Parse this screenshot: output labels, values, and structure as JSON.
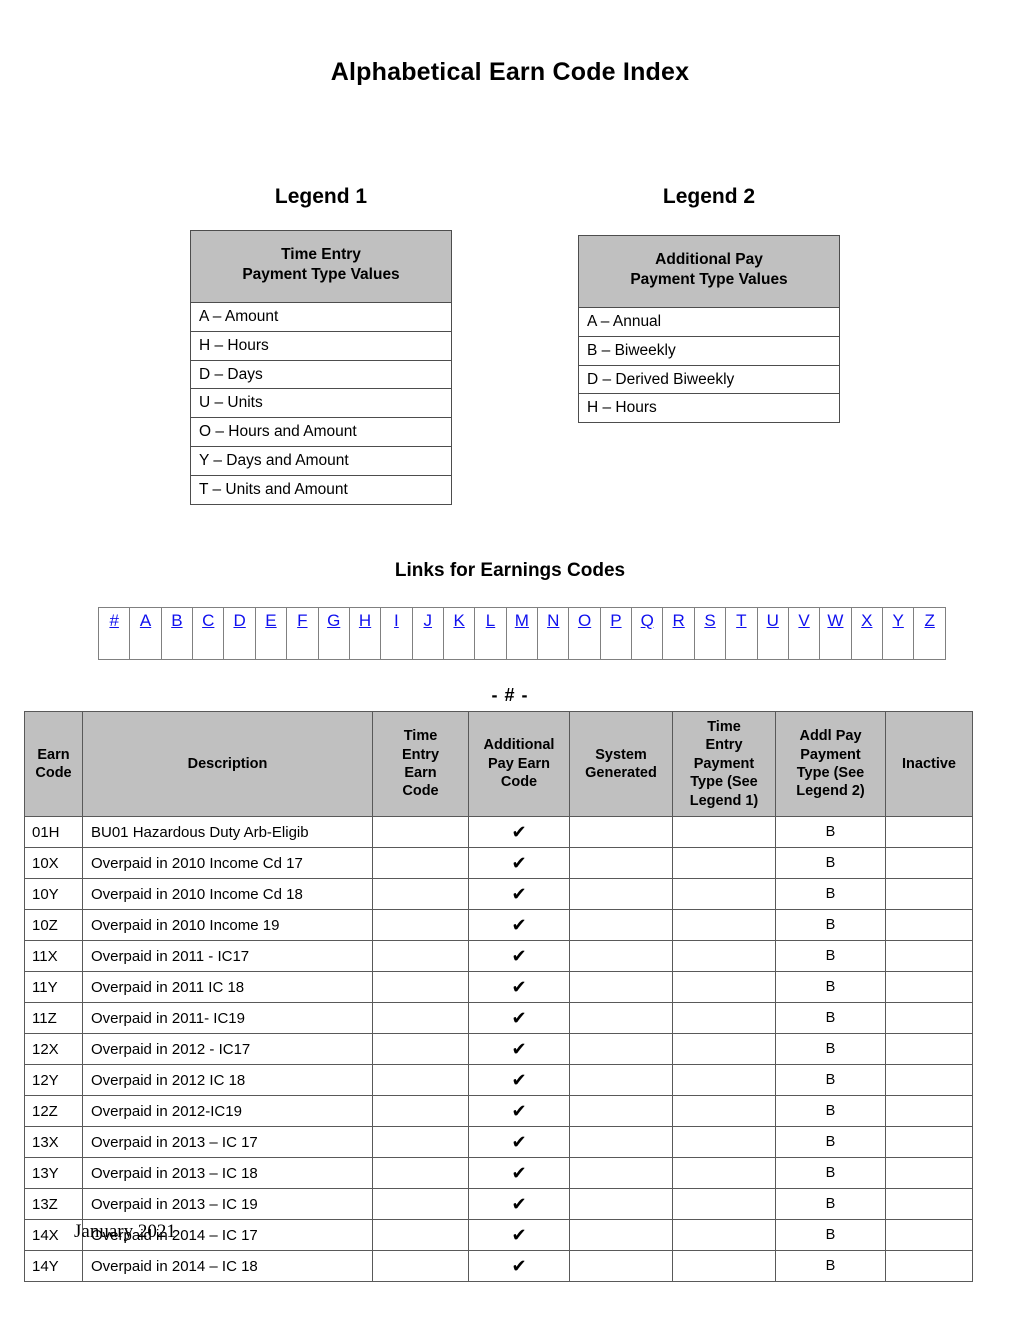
{
  "document": {
    "title": "Alphabetical Earn Code Index",
    "footer_date": "January 2021",
    "section_marker": "- # -",
    "header_gray": "#c0c0c0",
    "link_color": "#1010ee"
  },
  "legend1": {
    "heading": "Legend 1",
    "header_line1": "Time Entry",
    "header_line2": "Payment Type Values",
    "rows": [
      "A – Amount",
      "H – Hours",
      "D – Days",
      "U – Units",
      "O – Hours and Amount",
      "Y – Days and Amount",
      "T – Units and Amount"
    ]
  },
  "legend2": {
    "heading": "Legend 2",
    "header_line1": "Additional Pay",
    "header_line2": "Payment Type Values",
    "rows": [
      "A – Annual",
      "B – Biweekly",
      "D – Derived Biweekly",
      "H – Hours"
    ]
  },
  "links": {
    "heading": "Links for Earnings Codes",
    "items": [
      "#",
      "A",
      "B",
      "C",
      "D",
      "E",
      "F",
      "G",
      "H",
      "I",
      "J",
      "K",
      "L",
      "M",
      "N",
      "O",
      "P",
      "Q",
      "R",
      "S",
      "T",
      "U",
      "V",
      "W",
      "X",
      "Y",
      "Z"
    ]
  },
  "earn_table": {
    "columns": [
      "Earn Code",
      "Description",
      "Time Entry Earn Code",
      "Additional Pay Earn Code",
      "System Generated",
      "Time Entry Payment Type (See Legend 1)",
      "Addl Pay Payment Type (See Legend 2)",
      "Inactive"
    ],
    "column_lines": [
      [
        "Earn",
        "Code"
      ],
      [
        "Description"
      ],
      [
        "Time",
        "Entry",
        "Earn",
        "Code"
      ],
      [
        "Additional",
        "Pay Earn",
        "Code"
      ],
      [
        "System",
        "Generated"
      ],
      [
        "Time",
        "Entry",
        "Payment",
        "Type (See",
        "Legend 1)"
      ],
      [
        "Addl Pay",
        "Payment",
        "Type (See",
        "Legend 2)"
      ],
      [
        "Inactive"
      ]
    ],
    "check_glyph": "✔",
    "rows": [
      {
        "earn_code": "01H",
        "description": "BU01 Hazardous Duty Arb-Eligib",
        "time_entry_earn_code": "",
        "additional_pay_earn_code": "✔",
        "system_generated": "",
        "time_entry_payment_type": "",
        "addl_pay_payment_type": "B",
        "inactive": ""
      },
      {
        "earn_code": "10X",
        "description": "Overpaid in 2010 Income Cd 17",
        "time_entry_earn_code": "",
        "additional_pay_earn_code": "✔",
        "system_generated": "",
        "time_entry_payment_type": "",
        "addl_pay_payment_type": "B",
        "inactive": ""
      },
      {
        "earn_code": "10Y",
        "description": "Overpaid in 2010 Income Cd 18",
        "time_entry_earn_code": "",
        "additional_pay_earn_code": "✔",
        "system_generated": "",
        "time_entry_payment_type": "",
        "addl_pay_payment_type": "B",
        "inactive": ""
      },
      {
        "earn_code": "10Z",
        "description": "Overpaid in 2010 Income 19",
        "time_entry_earn_code": "",
        "additional_pay_earn_code": "✔",
        "system_generated": "",
        "time_entry_payment_type": "",
        "addl_pay_payment_type": "B",
        "inactive": ""
      },
      {
        "earn_code": "11X",
        "description": "Overpaid in 2011 - IC17",
        "time_entry_earn_code": "",
        "additional_pay_earn_code": "✔",
        "system_generated": "",
        "time_entry_payment_type": "",
        "addl_pay_payment_type": "B",
        "inactive": ""
      },
      {
        "earn_code": "11Y",
        "description": "Overpaid in 2011 IC 18",
        "time_entry_earn_code": "",
        "additional_pay_earn_code": "✔",
        "system_generated": "",
        "time_entry_payment_type": "",
        "addl_pay_payment_type": "B",
        "inactive": ""
      },
      {
        "earn_code": "11Z",
        "description": "Overpaid in 2011- IC19",
        "time_entry_earn_code": "",
        "additional_pay_earn_code": "✔",
        "system_generated": "",
        "time_entry_payment_type": "",
        "addl_pay_payment_type": "B",
        "inactive": ""
      },
      {
        "earn_code": "12X",
        "description": "Overpaid in 2012 - IC17",
        "time_entry_earn_code": "",
        "additional_pay_earn_code": "✔",
        "system_generated": "",
        "time_entry_payment_type": "",
        "addl_pay_payment_type": "B",
        "inactive": ""
      },
      {
        "earn_code": "12Y",
        "description": "Overpaid in 2012 IC 18",
        "time_entry_earn_code": "",
        "additional_pay_earn_code": "✔",
        "system_generated": "",
        "time_entry_payment_type": "",
        "addl_pay_payment_type": "B",
        "inactive": ""
      },
      {
        "earn_code": "12Z",
        "description": "Overpaid in 2012-IC19",
        "time_entry_earn_code": "",
        "additional_pay_earn_code": "✔",
        "system_generated": "",
        "time_entry_payment_type": "",
        "addl_pay_payment_type": "B",
        "inactive": ""
      },
      {
        "earn_code": "13X",
        "description": "Overpaid in 2013 – IC 17",
        "time_entry_earn_code": "",
        "additional_pay_earn_code": "✔",
        "system_generated": "",
        "time_entry_payment_type": "",
        "addl_pay_payment_type": "B",
        "inactive": ""
      },
      {
        "earn_code": "13Y",
        "description": "Overpaid in 2013 – IC 18",
        "time_entry_earn_code": "",
        "additional_pay_earn_code": "✔",
        "system_generated": "",
        "time_entry_payment_type": "",
        "addl_pay_payment_type": "B",
        "inactive": ""
      },
      {
        "earn_code": "13Z",
        "description": "Overpaid in 2013 – IC 19",
        "time_entry_earn_code": "",
        "additional_pay_earn_code": "✔",
        "system_generated": "",
        "time_entry_payment_type": "",
        "addl_pay_payment_type": "B",
        "inactive": ""
      },
      {
        "earn_code": "14X",
        "description": "Overpaid in 2014 – IC 17",
        "time_entry_earn_code": "",
        "additional_pay_earn_code": "✔",
        "system_generated": "",
        "time_entry_payment_type": "",
        "addl_pay_payment_type": "B",
        "inactive": ""
      },
      {
        "earn_code": "14Y",
        "description": "Overpaid in 2014 – IC 18",
        "time_entry_earn_code": "",
        "additional_pay_earn_code": "✔",
        "system_generated": "",
        "time_entry_payment_type": "",
        "addl_pay_payment_type": "B",
        "inactive": ""
      }
    ]
  }
}
